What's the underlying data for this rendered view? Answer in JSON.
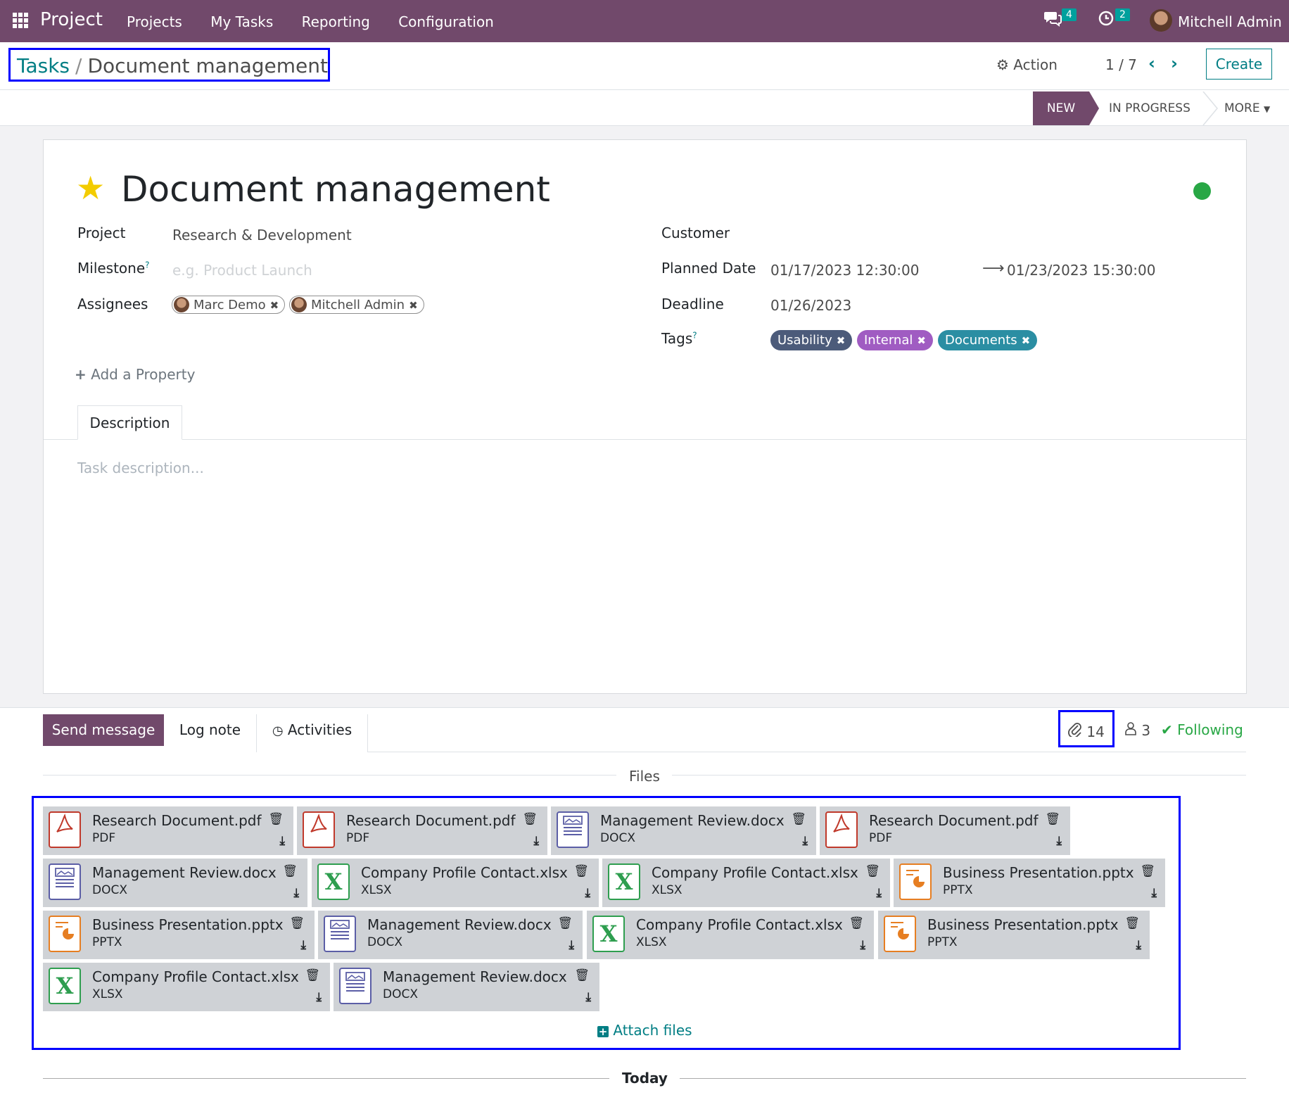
{
  "navbar": {
    "app_name": "Project",
    "menu": [
      "Projects",
      "My Tasks",
      "Reporting",
      "Configuration"
    ],
    "messages_icon": "chat-icon",
    "messages_count": "4",
    "activities_icon": "clock-icon",
    "activities_count": "2",
    "user": "Mitchell Admin"
  },
  "control": {
    "breadcrumb_parent": "Tasks",
    "breadcrumb_sep": "/",
    "breadcrumb_current": "Document management",
    "action_label": "Action",
    "pager": "1 / 7",
    "create_label": "Create"
  },
  "status": {
    "stages": [
      "NEW",
      "IN PROGRESS",
      "MORE"
    ],
    "active": "NEW"
  },
  "form": {
    "title": "Document management",
    "starred": true,
    "kanban_state_color": "#28a745",
    "project_label": "Project",
    "project_value": "Research & Development",
    "milestone_label": "Milestone",
    "milestone_placeholder": "e.g. Product Launch",
    "assignees_label": "Assignees",
    "assignees": [
      "Marc Demo",
      "Mitchell Admin"
    ],
    "customer_label": "Customer",
    "planned_label": "Planned Date",
    "planned_start": "01/17/2023 12:30:00",
    "planned_end": "01/23/2023 15:30:00",
    "deadline_label": "Deadline",
    "deadline_value": "01/26/2023",
    "tags_label": "Tags",
    "tags": [
      {
        "label": "Usability",
        "color": "#4c5b7a"
      },
      {
        "label": "Internal",
        "color": "#a05cc2"
      },
      {
        "label": "Documents",
        "color": "#2b8ea3"
      }
    ],
    "help_mark": "?",
    "add_property": "Add a Property",
    "tab_description": "Description",
    "description_placeholder": "Task description..."
  },
  "chatter": {
    "send_message": "Send message",
    "log_note": "Log note",
    "activities": "Activities",
    "attachment_count": "14",
    "follower_count": "3",
    "following": "Following",
    "files_label": "Files",
    "attach_files": "Attach files",
    "today_label": "Today",
    "attachments": [
      {
        "name": "Research Document.pdf",
        "ext": "PDF",
        "kind": "pdf"
      },
      {
        "name": "Research Document.pdf",
        "ext": "PDF",
        "kind": "pdf"
      },
      {
        "name": "Management Review.docx",
        "ext": "DOCX",
        "kind": "docx"
      },
      {
        "name": "Research Document.pdf",
        "ext": "PDF",
        "kind": "pdf"
      },
      {
        "name": "Management Review.docx",
        "ext": "DOCX",
        "kind": "docx"
      },
      {
        "name": "Company Profile Contact.xlsx",
        "ext": "XLSX",
        "kind": "xlsx"
      },
      {
        "name": "Company Profile Contact.xlsx",
        "ext": "XLSX",
        "kind": "xlsx"
      },
      {
        "name": "Business Presentation.pptx",
        "ext": "PPTX",
        "kind": "pptx"
      },
      {
        "name": "Business Presentation.pptx",
        "ext": "PPTX",
        "kind": "pptx"
      },
      {
        "name": "Management Review.docx",
        "ext": "DOCX",
        "kind": "docx"
      },
      {
        "name": "Company Profile Contact.xlsx",
        "ext": "XLSX",
        "kind": "xlsx"
      },
      {
        "name": "Business Presentation.pptx",
        "ext": "PPTX",
        "kind": "pptx"
      },
      {
        "name": "Company Profile Contact.xlsx",
        "ext": "XLSX",
        "kind": "xlsx"
      },
      {
        "name": "Management Review.docx",
        "ext": "DOCX",
        "kind": "docx"
      }
    ]
  }
}
